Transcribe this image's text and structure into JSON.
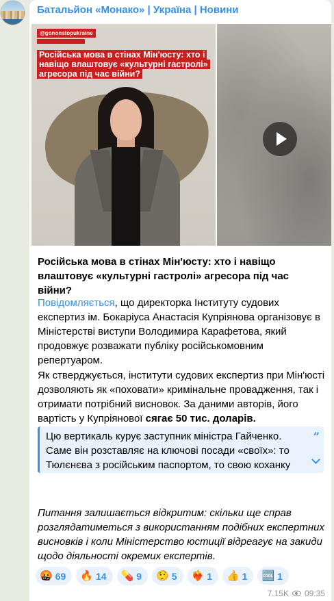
{
  "channel": {
    "name": "Батальйон «Монако» | Україна | Новини"
  },
  "media": {
    "image_handle": "@gononstopukraine",
    "image_headline": "Російська мова в стінах Мін'юсту: хто і навіщо влаштовує «культурні гастролі» агресора під час війни?"
  },
  "post": {
    "title": "Російська мова в стінах Мін'юсту: хто і навіщо влаштовує «культурні гастролі» агресора під час війни?",
    "p1_link": "Повідомляється",
    "p1_text": ", що директорка Інституту судових експертиз ім. Бокаріуса Анастасія Купріянова організовує в Міністерстві виступи Володимира Карафетова, який продовжує розважати публіку російськомовним репертуаром.",
    "p2_text": "Як стверджується, інститути судових експертиз при Мін'юсті дозволяють як «поховати» кримінальне провадження, так і отримати потрібний висновок. За даними авторів, його вартість у Купріянової ",
    "p2_bold": "сягає 50 тис. доларів.",
    "quote_text": "Цю вертикаль курує заступник міністра Гайченко. Саме він розставляє на ключові посади «своїх»: то Тюлєнєва з російським паспортом, то свою коханку Купріянову,…",
    "p3_text": "Питання залишається відкритим: скільки ще справ розглядатиметься з використанням подібних експертних висновків і коли Міністерство юстиції відреагує на закиди щодо діяльності окремих експертів."
  },
  "reactions": [
    {
      "emoji": "🤬",
      "count": "69"
    },
    {
      "emoji": "🔥",
      "count": "14"
    },
    {
      "emoji": "💊",
      "count": "9"
    },
    {
      "emoji": "🤥",
      "count": "5"
    },
    {
      "emoji": "❤️‍🔥",
      "count": "1"
    },
    {
      "emoji": "👍",
      "count": "1"
    },
    {
      "emoji": "🆒",
      "count": "1"
    }
  ],
  "footer": {
    "views": "7.15K",
    "time": "09:35"
  }
}
